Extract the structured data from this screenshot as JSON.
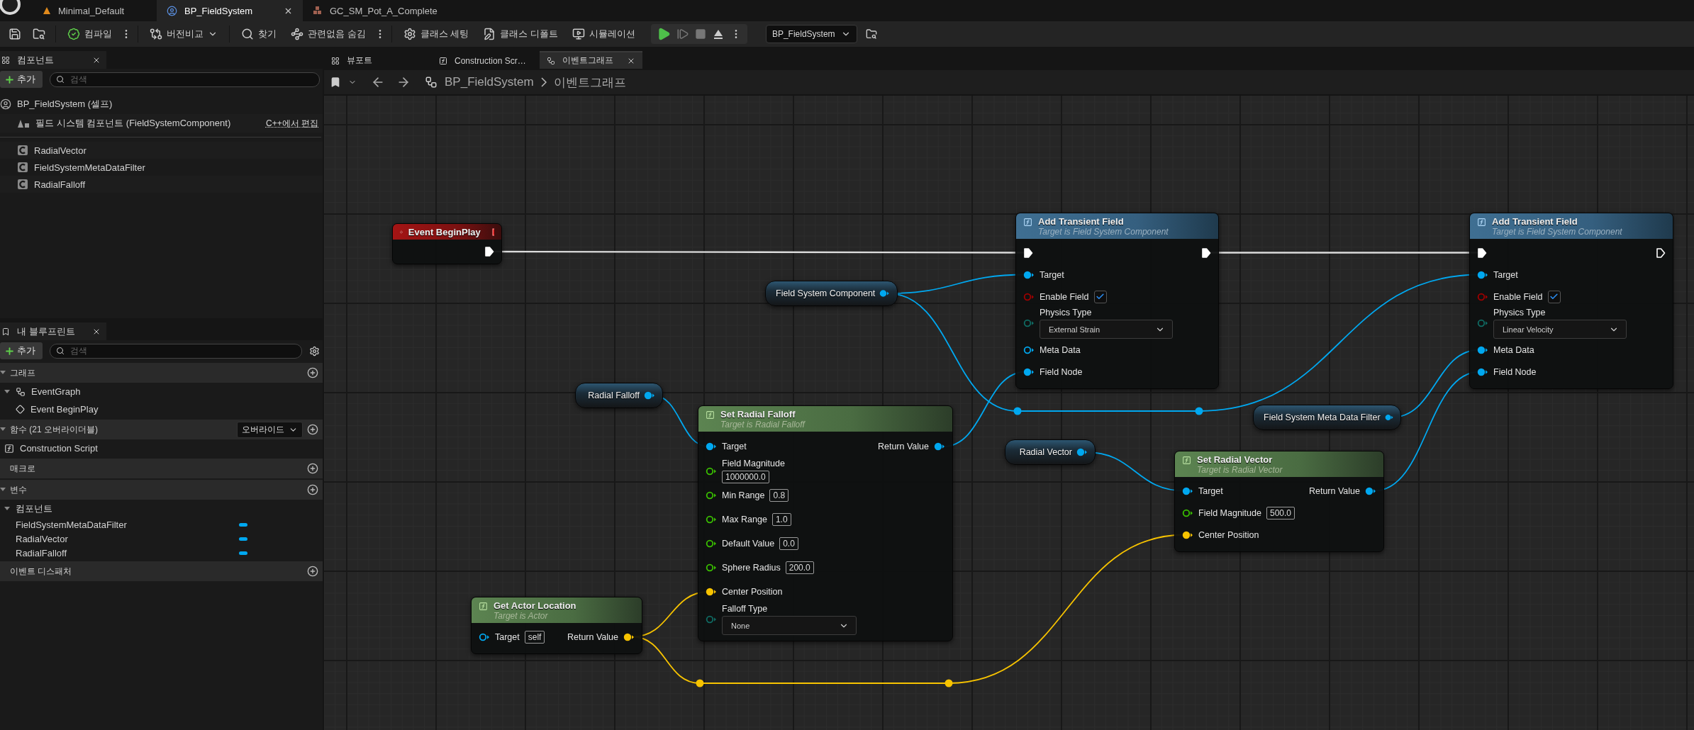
{
  "app_tabs": [
    {
      "label": "Minimal_Default",
      "selected": false
    },
    {
      "label": "BP_FieldSystem",
      "selected": true
    },
    {
      "label": "GC_SM_Pot_A_Complete",
      "selected": false
    }
  ],
  "toolbar": {
    "items": [
      {
        "label": "컴파일",
        "menu": true
      },
      {
        "label": "버전비교",
        "dropdown": true
      },
      {
        "label": "찾기"
      },
      {
        "label": "관련없음 숨김",
        "menu": true
      },
      {
        "label": "클래스 세팅"
      },
      {
        "label": "클래스 디폴트"
      },
      {
        "label": "시뮬레이션"
      }
    ],
    "debug_object": "BP_FieldSystem"
  },
  "components_panel": {
    "tab": "컴포넌트",
    "add_label": "추가",
    "search_placeholder": "검색",
    "root": {
      "label": "BP_FieldSystem (셀프)",
      "children": [
        {
          "label": "필드 시스템 컴포넌트 (FieldSystemComponent)",
          "action": "C++에서 편집"
        }
      ]
    },
    "items": [
      {
        "label": "RadialVector"
      },
      {
        "label": "FieldSystemMetaDataFilter"
      },
      {
        "label": "RadialFalloff"
      }
    ]
  },
  "my_blueprint": {
    "tab": "내 블루프린트",
    "add_label": "추가",
    "search_placeholder": "검색",
    "sections": [
      {
        "title": "그래프",
        "items": [
          {
            "label": "EventGraph",
            "kind": "graph",
            "children": [
              {
                "label": "Event BeginPlay",
                "kind": "event"
              }
            ]
          }
        ]
      },
      {
        "title": "함수 (21 오버라이더블)",
        "action": "오버라이드",
        "items": [
          {
            "label": "Construction Script",
            "kind": "function"
          }
        ]
      },
      {
        "title": "매크로"
      },
      {
        "title": "변수",
        "items": [
          {
            "label": "컴포넌트",
            "kind": "category",
            "children": [
              {
                "label": "FieldSystemMetaDataFilter",
                "kind": "variable"
              },
              {
                "label": "RadialVector",
                "kind": "variable"
              },
              {
                "label": "RadialFalloff",
                "kind": "variable"
              }
            ]
          }
        ]
      },
      {
        "title": "이벤트 디스패처"
      }
    ]
  },
  "editor_tabs": [
    {
      "label": "뷰포트",
      "selected": false
    },
    {
      "label": "Construction Scr…",
      "selected": false
    },
    {
      "label": "이벤트그래프",
      "selected": true
    }
  ],
  "breadcrumb": [
    "BP_FieldSystem",
    "이벤트그래프"
  ],
  "graph": {
    "nodes": [
      {
        "kind": "event",
        "title": "Event BeginPlay",
        "outputs": [
          {
            "kind": "exec",
            "connected": true
          }
        ]
      },
      {
        "kind": "variable",
        "title": "Field System Component",
        "outputs": [
          {
            "kind": "object",
            "connected": true
          }
        ]
      },
      {
        "kind": "function",
        "title": "Add Transient Field",
        "subtitle": "Target is Field System Component",
        "inputs": [
          {
            "kind": "exec",
            "connected": true
          },
          {
            "label": "Target",
            "kind": "object",
            "connected": true
          },
          {
            "label": "Enable Field",
            "kind": "bool",
            "connected": false,
            "checked": true
          },
          {
            "label": "Physics Type",
            "kind": "enum",
            "connected": false,
            "value": "External Strain"
          },
          {
            "label": "Meta Data",
            "kind": "object",
            "connected": false
          },
          {
            "label": "Field Node",
            "kind": "object",
            "connected": true
          }
        ],
        "outputs": [
          {
            "kind": "exec",
            "connected": true
          }
        ]
      },
      {
        "kind": "function",
        "title": "Add Transient Field",
        "subtitle": "Target is Field System Component",
        "inputs": [
          {
            "kind": "exec",
            "connected": true
          },
          {
            "label": "Target",
            "kind": "object",
            "connected": true
          },
          {
            "label": "Enable Field",
            "kind": "bool",
            "connected": false,
            "checked": true
          },
          {
            "label": "Physics Type",
            "kind": "enum",
            "connected": false,
            "value": "Linear Velocity"
          },
          {
            "label": "Meta Data",
            "kind": "object",
            "connected": true
          },
          {
            "label": "Field Node",
            "kind": "object",
            "connected": true
          }
        ],
        "outputs": [
          {
            "kind": "exec",
            "connected": false
          }
        ]
      },
      {
        "kind": "variable",
        "title": "Radial Falloff",
        "outputs": [
          {
            "kind": "object",
            "connected": true
          }
        ]
      },
      {
        "kind": "pure_function",
        "title": "Set Radial Falloff",
        "subtitle": "Target is Radial Falloff",
        "inputs": [
          {
            "label": "Target",
            "kind": "object",
            "connected": true
          },
          {
            "label": "Field Magnitude",
            "kind": "float",
            "connected": false,
            "value": "1000000.0",
            "value_below": true
          },
          {
            "label": "Min Range",
            "kind": "float",
            "connected": false,
            "value": "0.8"
          },
          {
            "label": "Max Range",
            "kind": "float",
            "connected": false,
            "value": "1.0"
          },
          {
            "label": "Default Value",
            "kind": "float",
            "connected": false,
            "value": "0.0"
          },
          {
            "label": "Sphere Radius",
            "kind": "float",
            "connected": false,
            "value": "200.0"
          },
          {
            "label": "Center Position",
            "kind": "vector",
            "connected": true
          },
          {
            "label": "Falloff Type",
            "kind": "enum",
            "connected": false,
            "value": "None"
          }
        ],
        "outputs": [
          {
            "label": "Return Value",
            "kind": "object",
            "connected": true
          }
        ]
      },
      {
        "kind": "variable",
        "title": "Radial Vector",
        "outputs": [
          {
            "kind": "object",
            "connected": true
          }
        ]
      },
      {
        "kind": "variable",
        "title": "Field System Meta Data Filter",
        "outputs": [
          {
            "kind": "object",
            "connected": true
          }
        ]
      },
      {
        "kind": "pure_function",
        "title": "Set Radial Vector",
        "subtitle": "Target is Radial Vector",
        "inputs": [
          {
            "label": "Target",
            "kind": "object",
            "connected": true
          },
          {
            "label": "Field Magnitude",
            "kind": "float",
            "connected": false,
            "value": "500.0"
          },
          {
            "label": "Center Position",
            "kind": "vector",
            "connected": true
          }
        ],
        "outputs": [
          {
            "label": "Return Value",
            "kind": "object",
            "connected": true
          }
        ]
      },
      {
        "kind": "pure_function",
        "title": "Get Actor Location",
        "subtitle": "Target is Actor",
        "inputs": [
          {
            "label": "Target",
            "kind": "object",
            "connected": false,
            "value": "self"
          }
        ],
        "outputs": [
          {
            "label": "Return Value",
            "kind": "vector",
            "connected": true
          }
        ]
      }
    ]
  }
}
